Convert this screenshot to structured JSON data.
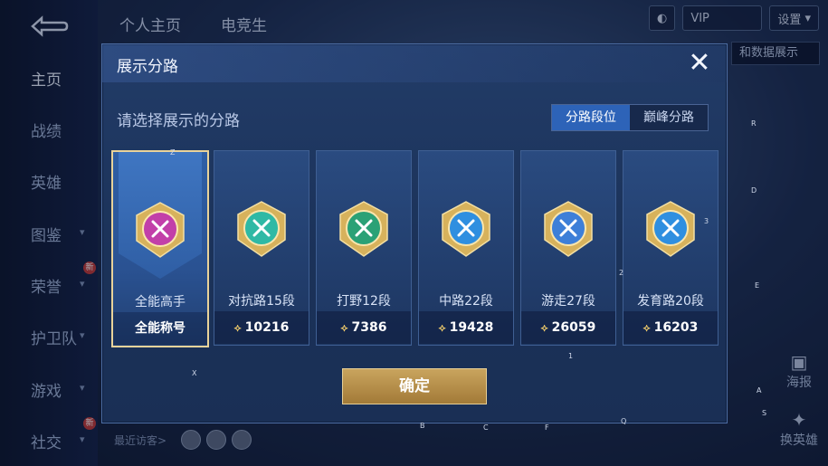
{
  "background": {
    "back_label": "",
    "top_tabs": [
      "个人主页",
      "电竞生"
    ],
    "settings_label": "设置",
    "showcase_tag": "和数据展示",
    "sidebar": [
      {
        "label": "主页",
        "active": true,
        "chevron": false,
        "new": false
      },
      {
        "label": "战绩",
        "active": false,
        "chevron": false,
        "new": false
      },
      {
        "label": "英雄",
        "active": false,
        "chevron": false,
        "new": false
      },
      {
        "label": "图鉴",
        "active": false,
        "chevron": true,
        "new": false
      },
      {
        "label": "荣誉",
        "active": false,
        "chevron": true,
        "new": true
      },
      {
        "label": "护卫队",
        "active": false,
        "chevron": true,
        "new": false
      },
      {
        "label": "游戏",
        "active": false,
        "chevron": true,
        "new": false
      },
      {
        "label": "社交",
        "active": false,
        "chevron": true,
        "new": true
      }
    ],
    "new_badge": "新",
    "visitors_label": "最近访客>",
    "right_controls": [
      "海报",
      "换英雄"
    ]
  },
  "modal": {
    "title": "展示分路",
    "subtitle": "请选择展示的分路",
    "close_glyph": "✕",
    "segment": {
      "options": [
        "分路段位",
        "巅峰分路"
      ],
      "selected": 0
    },
    "cards": [
      {
        "name": "全能高手",
        "score": "全能称号",
        "selected": true,
        "emblem_color": "#c23fa9",
        "show_icon": false
      },
      {
        "name": "对抗路15段",
        "score": "10216",
        "selected": false,
        "emblem_color": "#2fb9a5",
        "show_icon": true
      },
      {
        "name": "打野12段",
        "score": "7386",
        "selected": false,
        "emblem_color": "#2aa176",
        "show_icon": true
      },
      {
        "name": "中路22段",
        "score": "19428",
        "selected": false,
        "emblem_color": "#2f8fe0",
        "show_icon": true
      },
      {
        "name": "游走27段",
        "score": "26059",
        "selected": false,
        "emblem_color": "#3d7fd8",
        "show_icon": true
      },
      {
        "name": "发育路20段",
        "score": "16203",
        "selected": false,
        "emblem_color": "#2f8fe0",
        "show_icon": true
      }
    ],
    "confirm_label": "确定"
  },
  "overlay_markers": [
    "Z",
    "X",
    "2",
    "1",
    "3",
    "R",
    "D",
    "E",
    "A",
    "S",
    "B",
    "C",
    "F",
    "Q"
  ]
}
